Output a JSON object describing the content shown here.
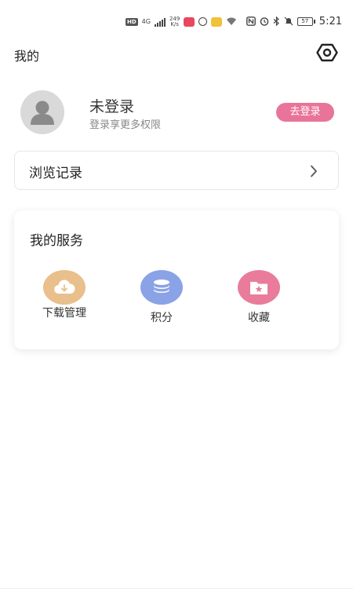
{
  "status_bar": {
    "network_badge": "HD",
    "network_type": "4G",
    "speed_value": "249",
    "speed_unit": "K/s",
    "battery": "57",
    "time": "5:21",
    "icons": [
      "hd-icon",
      "signal-icon",
      "app-icon",
      "circle-icon",
      "app-icon",
      "wifi-icon",
      "nfc-icon",
      "alarm-icon",
      "bluetooth-icon",
      "mute-icon",
      "battery-icon"
    ]
  },
  "header": {
    "title": "我的",
    "settings_icon": "settings-icon"
  },
  "profile": {
    "name": "未登录",
    "subtitle": "登录享更多权限",
    "login_button": "去登录",
    "avatar_icon": "user-avatar-icon"
  },
  "history": {
    "label": "浏览记录",
    "chevron_icon": "chevron-right-icon"
  },
  "services": {
    "title": "我的服务",
    "items": [
      {
        "label": "下载管理",
        "icon": "download-cloud-icon",
        "color": "#e9bf8c"
      },
      {
        "label": "积分",
        "icon": "coins-icon",
        "color": "#8aa3e6"
      },
      {
        "label": "收藏",
        "icon": "favorite-folder-icon",
        "color": "#e97c9a"
      }
    ]
  },
  "colors": {
    "accent": "#e9749a",
    "text": "#222222",
    "subtext": "#888888"
  }
}
